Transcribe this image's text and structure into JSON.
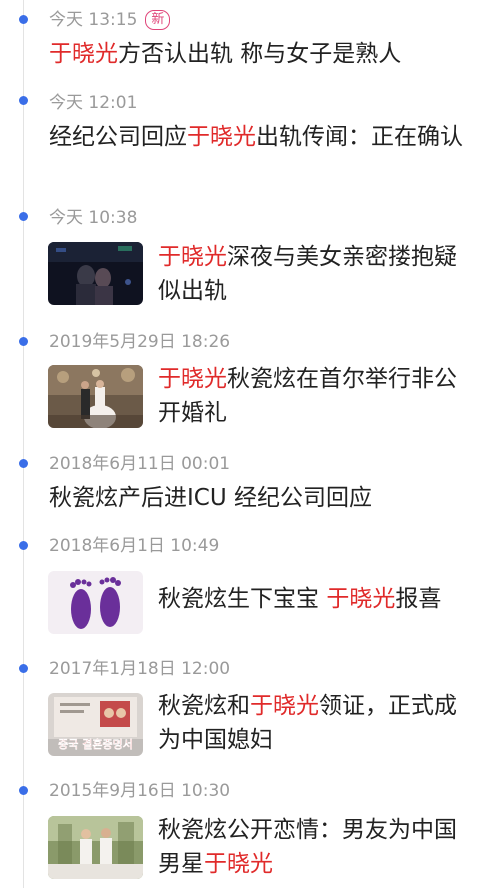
{
  "accent_color": "#3a6ee8",
  "highlight_color": "#e02a2a",
  "entries": [
    {
      "time": "今天 13:15",
      "badge": "新",
      "title_parts": [
        {
          "text": "于晓光",
          "hl": true
        },
        {
          "text": "方否认出轨 称与女子是熟人",
          "hl": false
        }
      ],
      "thumb": null
    },
    {
      "time": "今天 12:01",
      "badge": null,
      "title_parts": [
        {
          "text": "经纪公司回应",
          "hl": false
        },
        {
          "text": "于晓光",
          "hl": true
        },
        {
          "text": "出轨传闻：正在确认",
          "hl": false
        }
      ],
      "thumb": null
    },
    {
      "time": "今天 10:38",
      "badge": null,
      "title_parts": [
        {
          "text": "于晓光",
          "hl": true
        },
        {
          "text": "深夜与美女亲密搂抱疑似出轨",
          "hl": false
        }
      ],
      "thumb": "night-street-photo"
    },
    {
      "time": "2019年5月29日 18:26",
      "badge": null,
      "title_parts": [
        {
          "text": "于晓光",
          "hl": true
        },
        {
          "text": "秋瓷炫在首尔举行非公开婚礼",
          "hl": false
        }
      ],
      "thumb": "wedding-photo"
    },
    {
      "time": "2018年6月11日 00:01",
      "badge": null,
      "title_parts": [
        {
          "text": "秋瓷炫产后进ICU 经纪公司回应",
          "hl": false
        }
      ],
      "thumb": null
    },
    {
      "time": "2018年6月1日 10:49",
      "badge": null,
      "title_parts": [
        {
          "text": "秋瓷炫生下宝宝 ",
          "hl": false
        },
        {
          "text": "于晓光",
          "hl": true
        },
        {
          "text": "报喜",
          "hl": false
        }
      ],
      "thumb": "baby-footprints-photo"
    },
    {
      "time": "2017年1月18日 12:00",
      "badge": null,
      "title_parts": [
        {
          "text": "秋瓷炫和",
          "hl": false
        },
        {
          "text": "于晓光",
          "hl": true
        },
        {
          "text": "领证，正式成为中国媳妇",
          "hl": false
        }
      ],
      "thumb": "marriage-certificate-photo",
      "thumb_caption": "중국 결혼증명서"
    },
    {
      "time": "2015年9月16日 10:30",
      "badge": null,
      "title_parts": [
        {
          "text": "秋瓷炫公开恋情：男友为中国男星",
          "hl": false
        },
        {
          "text": "于晓光",
          "hl": true
        }
      ],
      "thumb": "couple-photo"
    }
  ]
}
